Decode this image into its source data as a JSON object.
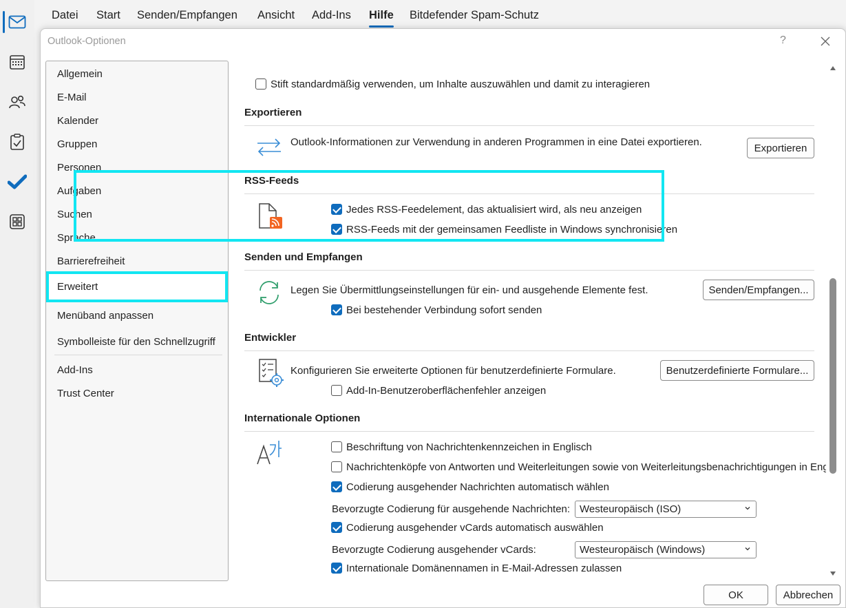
{
  "menubar": {
    "items": [
      "Datei",
      "Start",
      "Senden/Empfangen",
      "Ansicht",
      "Add-Ins",
      "Hilfe",
      "Bitdefender Spam-Schutz"
    ],
    "active": "Hilfe"
  },
  "dialog": {
    "title": "Outlook-Optionen",
    "help": "?",
    "ok_label": "OK",
    "cancel_label": "Abbrechen"
  },
  "categories": {
    "items": [
      "Allgemein",
      "E-Mail",
      "Kalender",
      "Gruppen",
      "Personen",
      "Aufgaben",
      "Suchen",
      "Sprache",
      "Barrierefreiheit",
      "Erweitert",
      "Menüband anpassen",
      "Symbolleiste für den Schnellzugriff",
      "Add-Ins",
      "Trust Center"
    ],
    "selected": "Erweitert"
  },
  "content": {
    "pen_option": {
      "label": "Stift standardmäßig verwenden, um Inhalte auszuwählen und damit zu interagieren",
      "checked": false
    },
    "export": {
      "title": "Exportieren",
      "description": "Outlook-Informationen zur Verwendung in anderen Programmen in eine Datei exportieren.",
      "button": "Exportieren"
    },
    "rss": {
      "title": "RSS-Feeds",
      "option1": {
        "label": "Jedes RSS-Feedelement, das aktualisiert wird, als neu anzeigen",
        "checked": true
      },
      "option2": {
        "label": "RSS-Feeds mit der gemeinsamen Feedliste in Windows synchronisieren",
        "checked": true
      }
    },
    "send_receive": {
      "title": "Senden und Empfangen",
      "description": "Legen Sie Übermittlungseinstellungen für ein- und ausgehende Elemente fest.",
      "button": "Senden/Empfangen...",
      "option1": {
        "label": "Bei bestehender Verbindung sofort senden",
        "checked": true
      }
    },
    "developer": {
      "title": "Entwickler",
      "description": "Konfigurieren Sie erweiterte Optionen für benutzerdefinierte Formulare.",
      "button": "Benutzerdefinierte Formulare...",
      "option1": {
        "label": "Add-In-Benutzeroberflächenfehler anzeigen",
        "checked": false
      }
    },
    "international": {
      "title": "Internationale Optionen",
      "option1": {
        "label": "Beschriftung von Nachrichtenkennzeichen in Englisch",
        "checked": false
      },
      "option2": {
        "label": "Nachrichtenköpfe von Antworten und Weiterleitungen sowie von Weiterleitungsbenachrichtigungen in Englisch",
        "checked": false
      },
      "option3": {
        "label": "Codierung ausgehender Nachrichten automatisch wählen",
        "checked": true
      },
      "encoding_label": "Bevorzugte Codierung für ausgehende Nachrichten:",
      "encoding_value": "Westeuropäisch (ISO)",
      "option4": {
        "label": "Codierung ausgehender vCards automatisch auswählen",
        "checked": true
      },
      "vcard_label": "Bevorzugte Codierung ausgehender vCards:",
      "vcard_value": "Westeuropäisch (Windows)",
      "option5": {
        "label": "Internationale Domänennamen in E-Mail-Adressen zulassen",
        "checked": true
      }
    }
  },
  "colors": {
    "accent": "#0f6cbd",
    "highlight": "#12e6f2",
    "rss_orange": "#f26522",
    "sync_green": "#2e9d6b"
  },
  "icons": {
    "rail": [
      "mail-icon",
      "calendar-icon",
      "people-icon",
      "tasks-icon",
      "todo-icon",
      "apps-icon"
    ],
    "export": "export-arrows-icon",
    "rss": "rss-document-icon",
    "send_receive": "sync-icon",
    "developer": "form-settings-icon",
    "international": "language-icon"
  }
}
